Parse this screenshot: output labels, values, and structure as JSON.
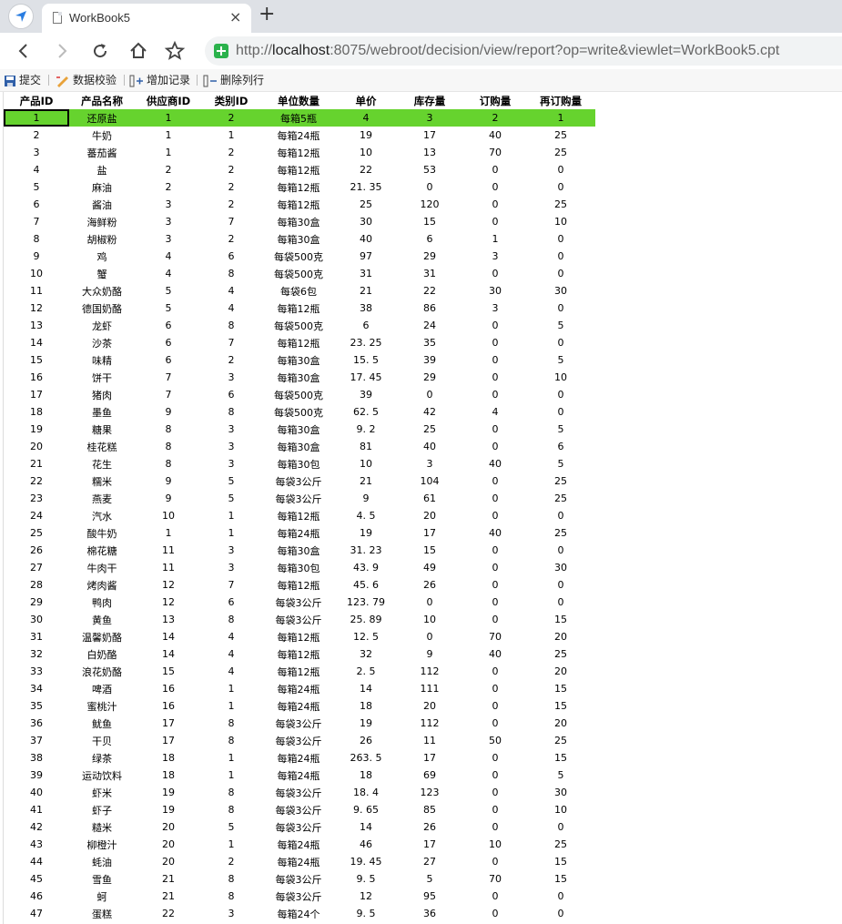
{
  "browser": {
    "tab_title": "WorkBook5",
    "tab_close": "×",
    "new_tab": "+",
    "url_scheme": "http://",
    "url_host": "localhost",
    "url_rest": ":8075/webroot/decision/view/report?op=write&viewlet=WorkBook5.cpt"
  },
  "toolbar": {
    "submit_label": "提交",
    "validate_label": "数据校验",
    "add_record_label": "增加记录",
    "delete_row_label": "删除列行"
  },
  "report": {
    "columns": [
      "产品ID",
      "产品名称",
      "供应商ID",
      "类别ID",
      "单位数量",
      "单价",
      "库存量",
      "订购量",
      "再订购量"
    ],
    "rows": [
      [
        "1",
        "还原盐",
        "1",
        "2",
        "每箱5瓶",
        "4",
        "3",
        "2",
        "1"
      ],
      [
        "2",
        "牛奶",
        "1",
        "1",
        "每箱24瓶",
        "19",
        "17",
        "40",
        "25"
      ],
      [
        "3",
        "蕃茄酱",
        "1",
        "2",
        "每箱12瓶",
        "10",
        "13",
        "70",
        "25"
      ],
      [
        "4",
        "盐",
        "2",
        "2",
        "每箱12瓶",
        "22",
        "53",
        "0",
        "0"
      ],
      [
        "5",
        "麻油",
        "2",
        "2",
        "每箱12瓶",
        "21. 35",
        "0",
        "0",
        "0"
      ],
      [
        "6",
        "酱油",
        "3",
        "2",
        "每箱12瓶",
        "25",
        "120",
        "0",
        "25"
      ],
      [
        "7",
        "海鲜粉",
        "3",
        "7",
        "每箱30盒",
        "30",
        "15",
        "0",
        "10"
      ],
      [
        "8",
        "胡椒粉",
        "3",
        "2",
        "每箱30盒",
        "40",
        "6",
        "1",
        "0"
      ],
      [
        "9",
        "鸡",
        "4",
        "6",
        "每袋500克",
        "97",
        "29",
        "3",
        "0"
      ],
      [
        "10",
        "蟹",
        "4",
        "8",
        "每袋500克",
        "31",
        "31",
        "0",
        "0"
      ],
      [
        "11",
        "大众奶酪",
        "5",
        "4",
        "每袋6包",
        "21",
        "22",
        "30",
        "30"
      ],
      [
        "12",
        "德国奶酪",
        "5",
        "4",
        "每箱12瓶",
        "38",
        "86",
        "3",
        "0"
      ],
      [
        "13",
        "龙虾",
        "6",
        "8",
        "每袋500克",
        "6",
        "24",
        "0",
        "5"
      ],
      [
        "14",
        "沙茶",
        "6",
        "7",
        "每箱12瓶",
        "23. 25",
        "35",
        "0",
        "0"
      ],
      [
        "15",
        "味精",
        "6",
        "2",
        "每箱30盒",
        "15. 5",
        "39",
        "0",
        "5"
      ],
      [
        "16",
        "饼干",
        "7",
        "3",
        "每箱30盒",
        "17. 45",
        "29",
        "0",
        "10"
      ],
      [
        "17",
        "猪肉",
        "7",
        "6",
        "每袋500克",
        "39",
        "0",
        "0",
        "0"
      ],
      [
        "18",
        "墨鱼",
        "9",
        "8",
        "每袋500克",
        "62. 5",
        "42",
        "4",
        "0"
      ],
      [
        "19",
        "糖果",
        "8",
        "3",
        "每箱30盒",
        "9. 2",
        "25",
        "0",
        "5"
      ],
      [
        "20",
        "桂花糕",
        "8",
        "3",
        "每箱30盒",
        "81",
        "40",
        "0",
        "6"
      ],
      [
        "21",
        "花生",
        "8",
        "3",
        "每箱30包",
        "10",
        "3",
        "40",
        "5"
      ],
      [
        "22",
        "糯米",
        "9",
        "5",
        "每袋3公斤",
        "21",
        "104",
        "0",
        "25"
      ],
      [
        "23",
        "燕麦",
        "9",
        "5",
        "每袋3公斤",
        "9",
        "61",
        "0",
        "25"
      ],
      [
        "24",
        "汽水",
        "10",
        "1",
        "每箱12瓶",
        "4. 5",
        "20",
        "0",
        "0"
      ],
      [
        "25",
        "酸牛奶",
        "1",
        "1",
        "每箱24瓶",
        "19",
        "17",
        "40",
        "25"
      ],
      [
        "26",
        "棉花糖",
        "11",
        "3",
        "每箱30盒",
        "31. 23",
        "15",
        "0",
        "0"
      ],
      [
        "27",
        "牛肉干",
        "11",
        "3",
        "每箱30包",
        "43. 9",
        "49",
        "0",
        "30"
      ],
      [
        "28",
        "烤肉酱",
        "12",
        "7",
        "每箱12瓶",
        "45. 6",
        "26",
        "0",
        "0"
      ],
      [
        "29",
        "鸭肉",
        "12",
        "6",
        "每袋3公斤",
        "123. 79",
        "0",
        "0",
        "0"
      ],
      [
        "30",
        "黄鱼",
        "13",
        "8",
        "每袋3公斤",
        "25. 89",
        "10",
        "0",
        "15"
      ],
      [
        "31",
        "温馨奶酪",
        "14",
        "4",
        "每箱12瓶",
        "12. 5",
        "0",
        "70",
        "20"
      ],
      [
        "32",
        "白奶酪",
        "14",
        "4",
        "每箱12瓶",
        "32",
        "9",
        "40",
        "25"
      ],
      [
        "33",
        "浪花奶酪",
        "15",
        "4",
        "每箱12瓶",
        "2. 5",
        "112",
        "0",
        "20"
      ],
      [
        "34",
        "啤酒",
        "16",
        "1",
        "每箱24瓶",
        "14",
        "111",
        "0",
        "15"
      ],
      [
        "35",
        "蜜桃汁",
        "16",
        "1",
        "每箱24瓶",
        "18",
        "20",
        "0",
        "15"
      ],
      [
        "36",
        "鱿鱼",
        "17",
        "8",
        "每袋3公斤",
        "19",
        "112",
        "0",
        "20"
      ],
      [
        "37",
        "干贝",
        "17",
        "8",
        "每袋3公斤",
        "26",
        "11",
        "50",
        "25"
      ],
      [
        "38",
        "绿茶",
        "18",
        "1",
        "每箱24瓶",
        "263. 5",
        "17",
        "0",
        "15"
      ],
      [
        "39",
        "运动饮料",
        "18",
        "1",
        "每箱24瓶",
        "18",
        "69",
        "0",
        "5"
      ],
      [
        "40",
        "虾米",
        "19",
        "8",
        "每袋3公斤",
        "18. 4",
        "123",
        "0",
        "30"
      ],
      [
        "41",
        "虾子",
        "19",
        "8",
        "每袋3公斤",
        "9. 65",
        "85",
        "0",
        "10"
      ],
      [
        "42",
        "糙米",
        "20",
        "5",
        "每袋3公斤",
        "14",
        "26",
        "0",
        "0"
      ],
      [
        "43",
        "柳橙汁",
        "20",
        "1",
        "每箱24瓶",
        "46",
        "17",
        "10",
        "25"
      ],
      [
        "44",
        "蚝油",
        "20",
        "2",
        "每箱24瓶",
        "19. 45",
        "27",
        "0",
        "15"
      ],
      [
        "45",
        "雪鱼",
        "21",
        "8",
        "每袋3公斤",
        "9. 5",
        "5",
        "70",
        "15"
      ],
      [
        "46",
        "蚵",
        "21",
        "8",
        "每袋3公斤",
        "12",
        "95",
        "0",
        "0"
      ],
      [
        "47",
        "蛋糕",
        "22",
        "3",
        "每箱24个",
        "9. 5",
        "36",
        "0",
        "0"
      ]
    ]
  }
}
